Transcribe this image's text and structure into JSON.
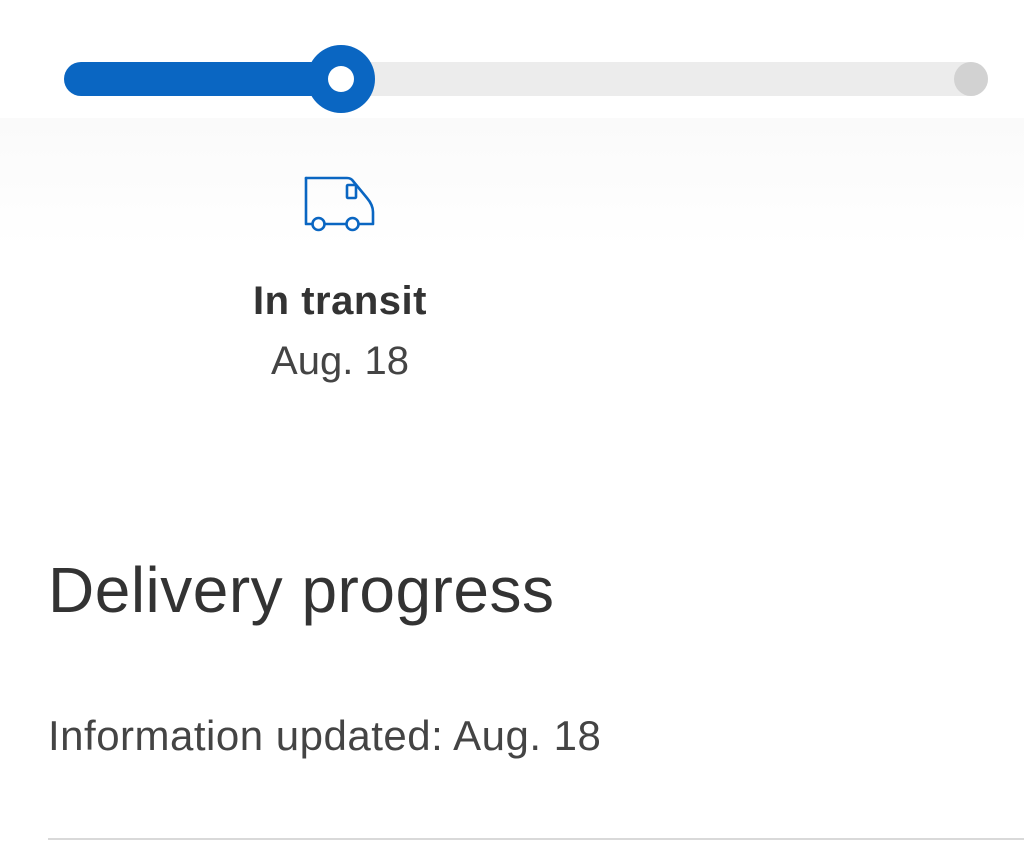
{
  "tracker": {
    "progress": 0.3,
    "current_step": {
      "status": "In transit",
      "date": "Aug. 18",
      "icon": "delivery-truck-icon"
    },
    "colors": {
      "accent": "#0a66c2",
      "track": "#ececec",
      "pending": "#d2d2d2"
    }
  },
  "section": {
    "title": "Delivery progress",
    "updated_text": "Information updated: Aug. 18"
  }
}
